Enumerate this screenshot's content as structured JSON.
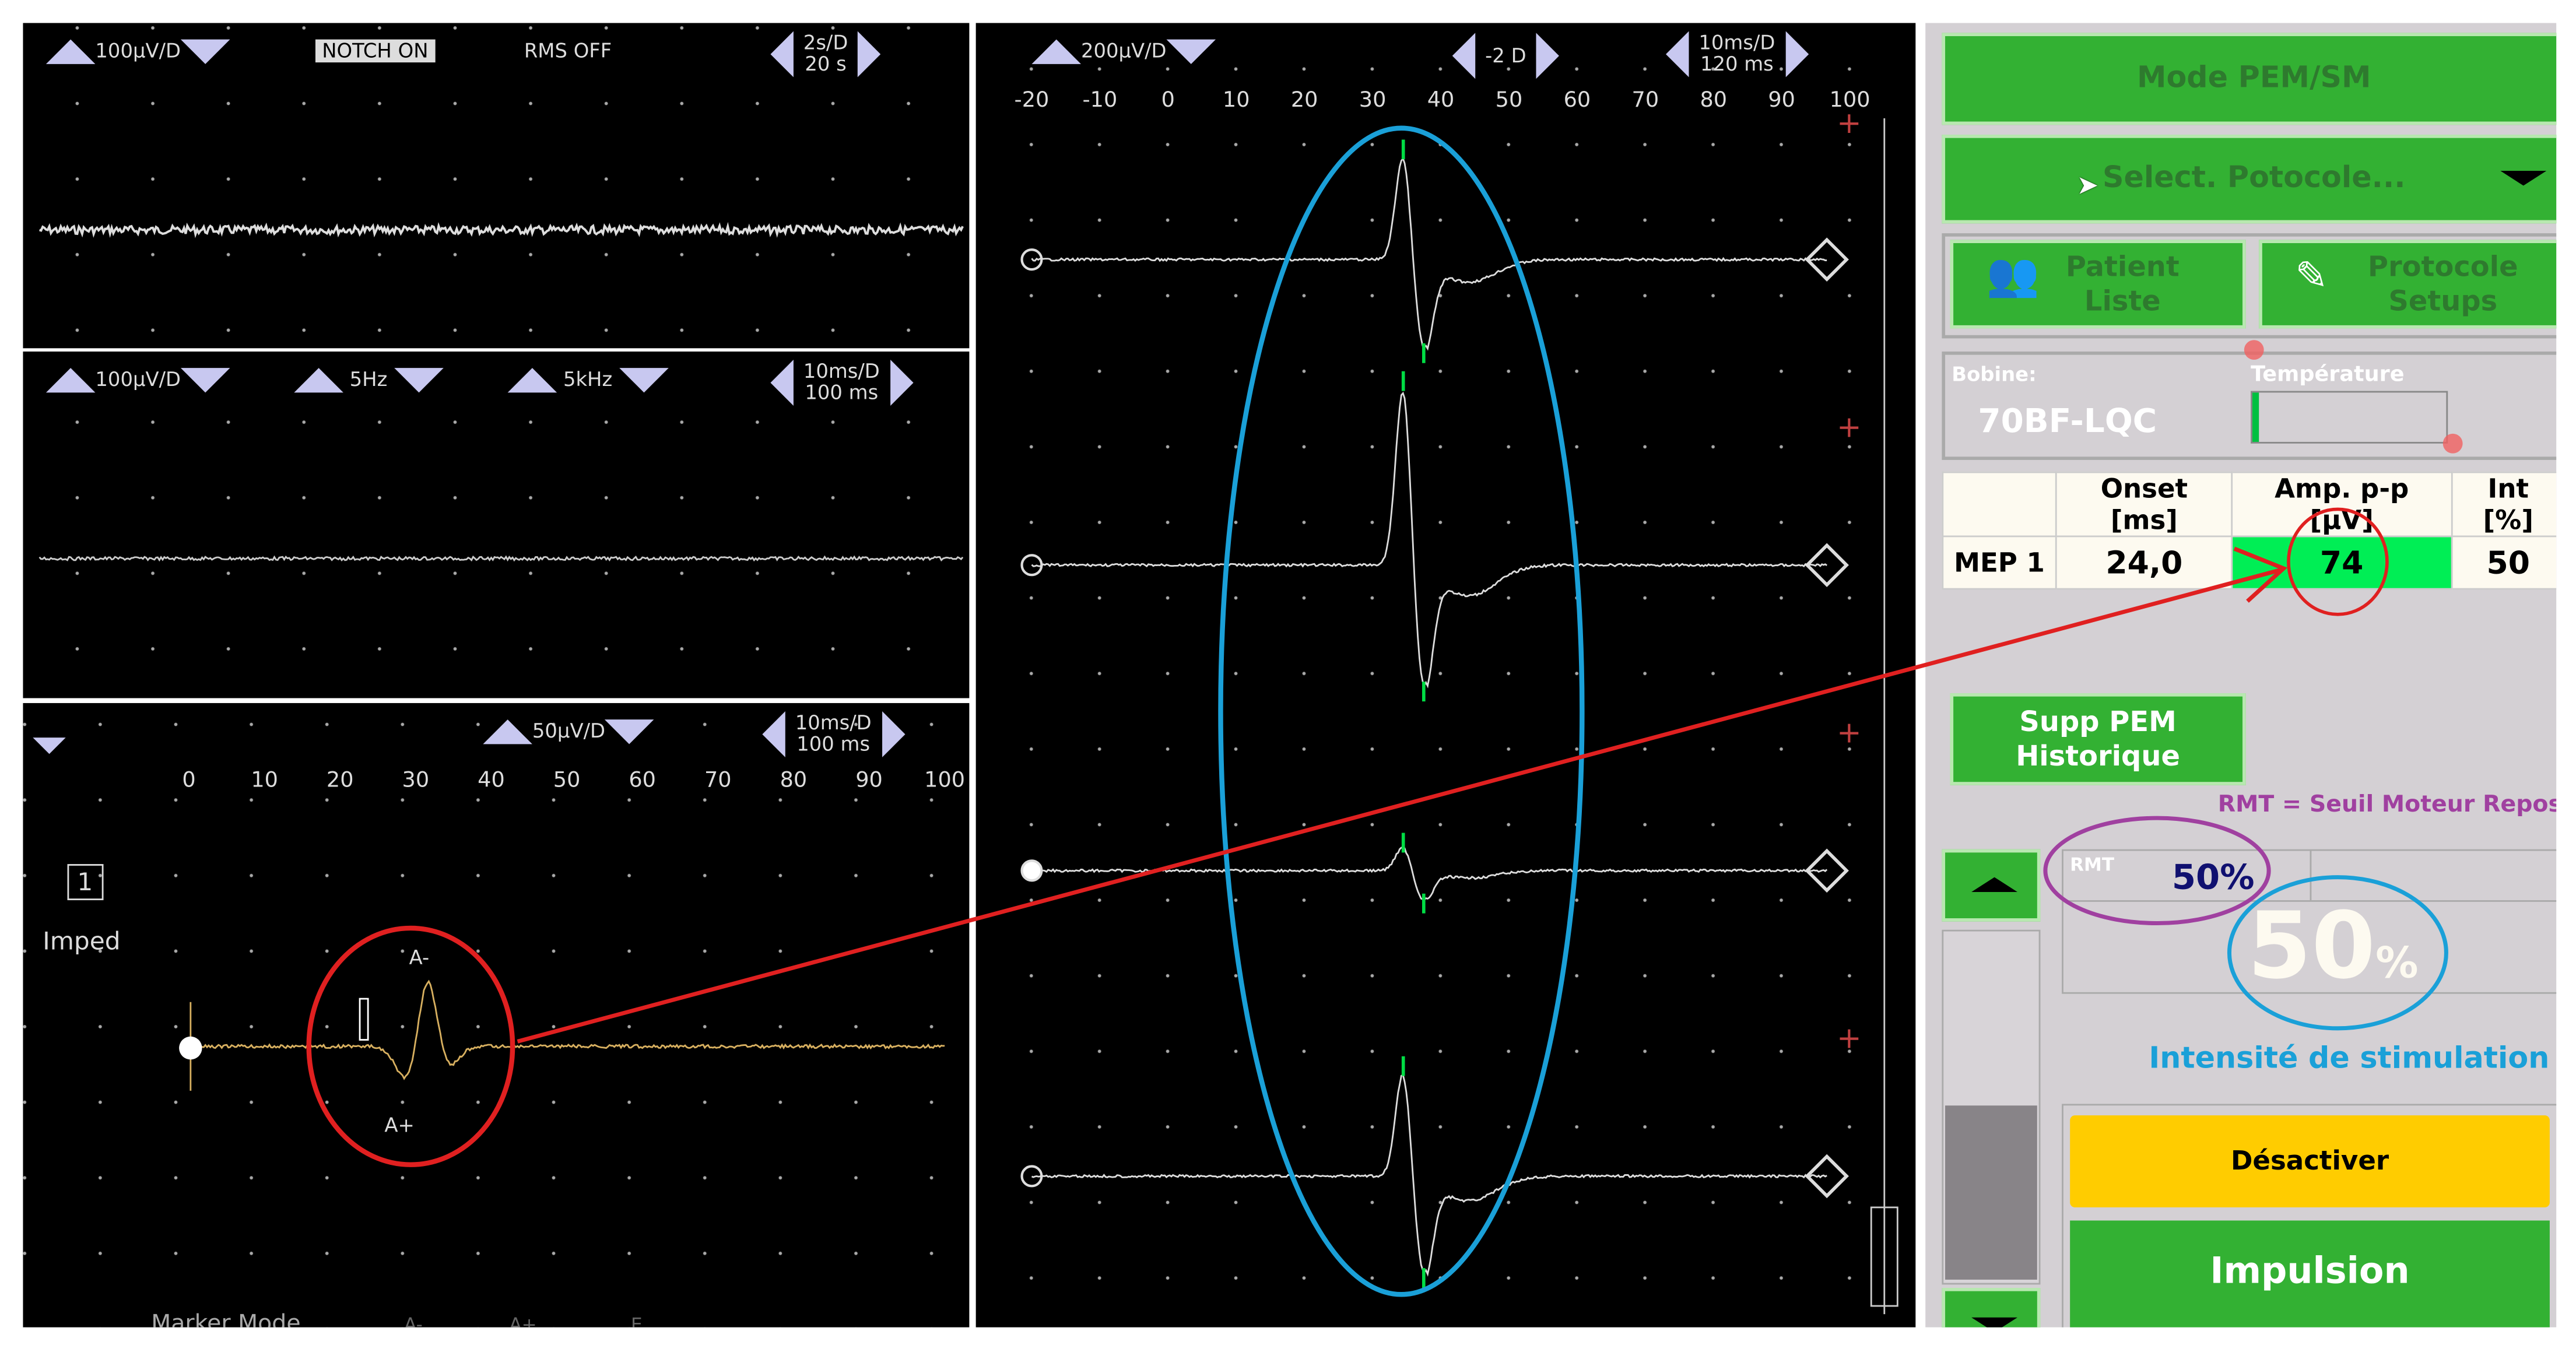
{
  "top_left_panel": {
    "gain": "100µV/D",
    "notch": "NOTCH ON",
    "rms": "RMS OFF",
    "timebase_line1": "2s/D",
    "timebase_line2": "20 s"
  },
  "mid_left_panel": {
    "gain": "100µV/D",
    "lowcut": "5Hz",
    "highcut": "5kHz",
    "timebase_line1": "10ms/D",
    "timebase_line2": "100 ms"
  },
  "bottom_left_panel": {
    "gain": "50µV/D",
    "timebase_line1": "10ms/D",
    "timebase_line2": "100 ms",
    "channel": "1",
    "imped": "Imped",
    "x_ticks": [
      "0",
      "10",
      "20",
      "30",
      "40",
      "50",
      "60",
      "70",
      "80",
      "90",
      "100"
    ],
    "marker_a_minus": "A-",
    "marker_a_plus": "A+",
    "marker_mode": "Marker Mode",
    "marker_opts": [
      "A-",
      "A+",
      "E"
    ]
  },
  "center_panel": {
    "gain": "200µV/D",
    "offset": "-2 D",
    "timebase_line1": "10ms/D",
    "timebase_line2": "120 ms",
    "x_ticks": [
      "-20",
      "-10",
      "0",
      "10",
      "20",
      "30",
      "40",
      "50",
      "60",
      "70",
      "80",
      "90",
      "100"
    ]
  },
  "right_panel": {
    "mode_button": "Mode PEM/SM",
    "protocol_select": "Select. Potocole...",
    "patient_button": [
      "Patient",
      "Liste"
    ],
    "protocol_button": [
      "Protocole",
      "Setups"
    ],
    "coil_label": "Bobine:",
    "coil_value": "70BF-LQC",
    "temp_label": "Température",
    "temperature_level": 0.03,
    "table": {
      "headers": [
        "",
        "Onset [ms]",
        "Amp. p-p [µV]",
        "Int [%]"
      ],
      "rows": [
        [
          "MEP 1",
          "24,0",
          "74",
          "50"
        ]
      ]
    },
    "supp_button": [
      "Supp PEM",
      "Historique"
    ],
    "rmt_note": "RMT = Seuil Moteur Repos",
    "rmt_label": "RMT",
    "rmt_value": "50%",
    "intensity_value": "50",
    "intensity_unit": "%",
    "intensity_label": "Intensité de stimulation",
    "deactivate_button": "Désactiver",
    "pulse_button": "Impulsion"
  },
  "colors": {
    "green": "#33b133",
    "highlight": "#00ee55",
    "yellow": "#ffcc00",
    "annot_red": "#e02020",
    "annot_blue": "#1aa0d8",
    "annot_purple": "#a040a0"
  }
}
